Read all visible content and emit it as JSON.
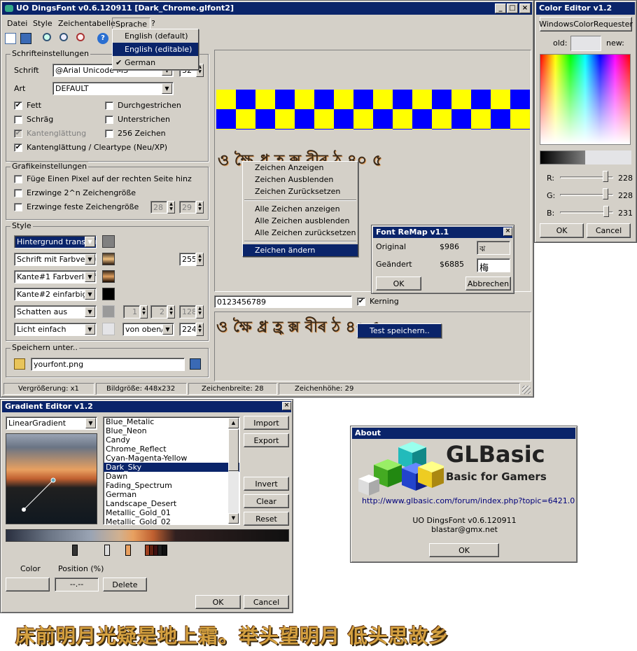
{
  "main": {
    "title": "UO DingsFont v0.6.120911 [Dark_Chrome.glfont2]",
    "menu": [
      "Datei",
      "Style",
      "Zeichentabelle",
      "Sprache",
      "?"
    ],
    "lang_menu": [
      "English (default)",
      "English (editable)",
      "German"
    ],
    "font_group": "Schrifteinstellungen",
    "font_label": "Schrift",
    "font_value": "@Arial Unicode MS",
    "font_size": "32",
    "art_label": "Art",
    "art_value": "DEFAULT",
    "checks": {
      "bold": "Fett",
      "strike": "Durchgestrichen",
      "italic": "Schräg",
      "underline": "Unterstrichen",
      "aa": "Kantenglättung",
      "chars256": "256 Zeichen",
      "cleartype": "Kantenglättung / Cleartype (Neu/XP)"
    },
    "gfx_group": "Grafikeinstellungen",
    "gfx": {
      "pixel": "Füge Einen Pixel auf der rechten Seite hinz",
      "pow2": "Erzwinge 2^n Zeichengröße",
      "fixed": "Erzwinge feste Zeichengröße",
      "w": "28",
      "h": "29"
    },
    "style_group": "Style",
    "style": {
      "bg": "Hintergrund transparent",
      "font": "Schrift mit Farbverlauf",
      "font_val": "255",
      "edge1": "Kante#1 Farbverlauf",
      "edge2": "Kante#2 einfarbig",
      "shadow": "Schatten aus",
      "s1": "1",
      "s2": "2",
      "s3": "128",
      "light": "Licht einfach",
      "light_dir": "von oben/links",
      "light_val": "224"
    },
    "save_group": "Speichern unter..",
    "save_file": "yourfont.png",
    "ctx_menu": [
      "Zeichen Anzeigen",
      "Zeichen Ausblenden",
      "Zeichen Zurücksetzen",
      "Alle Zeichen anzeigen",
      "Alle Zeichen ausblenden",
      "Alle Zeichen zurücksetzen",
      "Zeichen ändern"
    ],
    "preview_input": "0123456789",
    "kerning": "Kerning",
    "sample_glyphs": "ও ক্ষৈ ধ্ৰ হ্ৰ ক্স বীৰ ঠ ৪০ ৫",
    "test_save": "Test speichern..",
    "status": [
      "Vergrößerung: x1",
      "Bildgröße: 448x232",
      "Zeichenbreite: 28",
      "Zeichenhöhe: 29"
    ]
  },
  "remap": {
    "title": "Font ReMap v1.1",
    "orig_label": "Original",
    "orig_code": "$986",
    "orig_char": "ঝ",
    "changed_label": "Geändert",
    "changed_code": "$6885",
    "changed_char": "梅",
    "ok": "OK",
    "cancel": "Abbrechen"
  },
  "color_editor": {
    "title": "Color Editor v1.2",
    "requester": "WindowsColorRequester",
    "old": "old:",
    "new": "new:",
    "r_label": "R:",
    "g_label": "G:",
    "b_label": "B:",
    "r": 228,
    "g": 228,
    "b": 231,
    "ok": "OK",
    "cancel": "Cancel"
  },
  "gradient_editor": {
    "title": "Gradient Editor v1.2",
    "type": "LinearGradient",
    "list": [
      "Blue_Metalic",
      "Blue_Neon",
      "Candy",
      "Chrome_Reflect",
      "Cyan-Magenta-Yellow",
      "Dark_Sky",
      "Dawn",
      "Fading_Spectrum",
      "German",
      "Landscape_Desert",
      "Metallic_Gold_01",
      "Metallic_Gold_02"
    ],
    "selected": "Dark_Sky",
    "import": "Import",
    "export": "Export",
    "invert": "Invert",
    "clear": "Clear",
    "reset": "Reset",
    "color_label": "Color",
    "position_label": "Position (%)",
    "position_value": "--.--",
    "delete": "Delete",
    "ok": "OK",
    "cancel": "Cancel"
  },
  "about": {
    "title": "About",
    "brand": "GLBasic",
    "tagline": "Basic for Gamers",
    "url": "http://www.glbasic.com/forum/index.php?topic=6421.0",
    "version": "UO DingsFont v0.6.120911",
    "email": "blastar@gmx.net",
    "ok": "OK"
  },
  "footer_text": "床前明月光疑是地上霜。举头望明月 低头思故乡"
}
